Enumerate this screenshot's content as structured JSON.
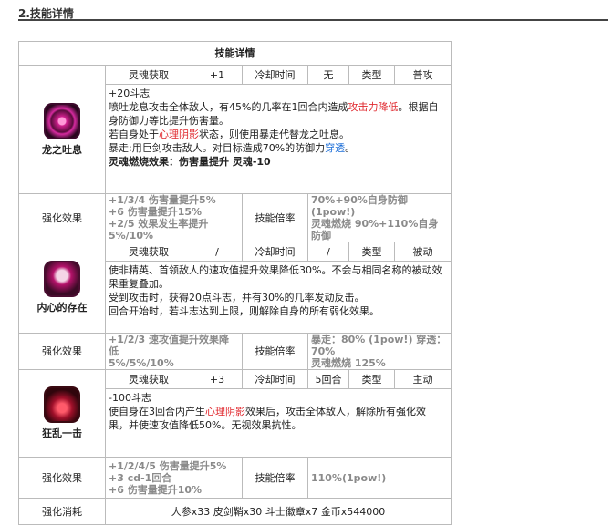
{
  "section_title": "2.技能详情",
  "table_title": "技能详情",
  "labels": {
    "soul_obtain": "灵魂获取",
    "cooldown": "冷却时间",
    "type": "类型",
    "enhance": "强化效果",
    "multiplier": "技能倍率",
    "consume": "强化消耗"
  },
  "skills": [
    {
      "name": "龙之吐息",
      "icon": "dragon-breath-icon",
      "soul": "+1",
      "cooldown": "无",
      "type": "普攻",
      "desc": {
        "l1": "+20斗志",
        "l2a": "喷吐龙息攻击全体敌人，有45%的几率在1回合内造成",
        "l2b": "攻击力降低",
        "l2c": "。根据自",
        "l3": "身防御力等比提升伤害量。",
        "l4a": "若自身处于",
        "l4b": "心理阴影",
        "l4c": "状态，则使用暴走代替龙之吐息。",
        "l5": "暴走:用巨剑攻击敌人。对目标造成70%的防御力",
        "l5b": "穿透",
        "l5c": "。",
        "l6": "灵魂燃烧效果：伤害量提升 灵魂-10"
      },
      "enhance": [
        "+1/3/4 伤害量提升5%",
        "+6 伤害量提升15%",
        "+2/5 效果发生率提升5%/10%"
      ],
      "multiplier": [
        "70%+90%自身防御(1pow!)",
        "灵魂燃烧 90%+110%自身防御"
      ]
    },
    {
      "name": "内心的存在",
      "icon": "inner-presence-icon",
      "soul": "/",
      "cooldown": "/",
      "type": "被动",
      "desc": {
        "l1": "使非精英、首领敌人的速攻值提升效果降低30%。不会与相同名称的被动效",
        "l2": "果重复叠加。",
        "l3": "受到攻击时，获得20点斗志，并有30%的几率发动反击。",
        "l4": "回合开始时，若斗志达到上限，则解除自身的所有弱化效果。"
      },
      "enhance": [
        "+1/2/3 速攻值提升效果降低",
        "5%/5%/10%"
      ],
      "multiplier": [
        "暴走：80% (1pow!) 穿透：70%",
        "灵魂燃烧 125%"
      ]
    },
    {
      "name": "狂乱一击",
      "icon": "frenzy-strike-icon",
      "soul": "+3",
      "cooldown": "5回合",
      "type": "主动",
      "desc": {
        "l1": "-100斗志",
        "l2a": "使自身在3回合内产生",
        "l2b": "心理阴影",
        "l2c": "效果后，攻击全体敌人，解除所有强化效",
        "l3": "果，并使速攻值降低50%。无视效果抗性。"
      },
      "enhance": [
        "+1/2/4/5 伤害量提升5%",
        "+3 cd-1回合",
        "+6 伤害量提升10%"
      ],
      "multiplier": [
        "110%(1pow!)"
      ]
    }
  ],
  "consume_value": "人参x33 皮剑鞘x30 斗士徽章x7 金币x544000"
}
